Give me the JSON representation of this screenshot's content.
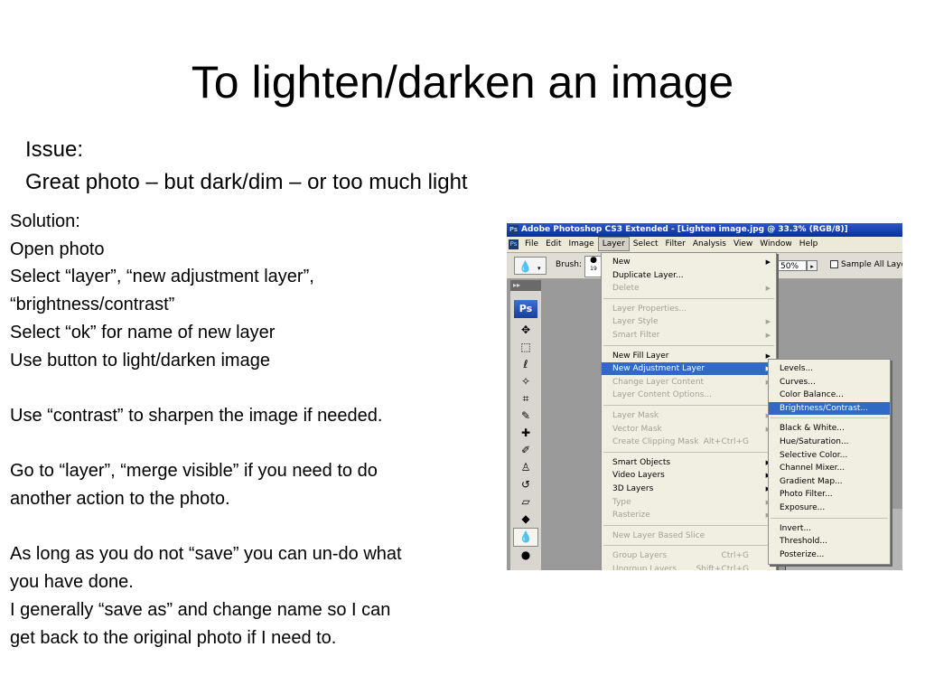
{
  "slide": {
    "title": "To lighten/darken an image",
    "issue": [
      "Issue:",
      "Great photo – but dark/dim – or too much light"
    ],
    "solution": [
      "Solution:",
      "Open photo",
      "Select “layer”, “new adjustment layer”,",
      "“brightness/contrast”",
      "Select “ok” for name of new layer",
      "Use button to light/darken image",
      "",
      "Use “contrast” to sharpen the image if needed.",
      "",
      "Go to “layer”, “merge visible” if you need to do",
      "another action to the photo.",
      "",
      "As long as you do not “save” you can un-do what",
      "you have done.",
      "I generally “save as” and change name so I can",
      "get back to the original photo if I need to."
    ]
  },
  "photoshop": {
    "title": "Adobe Photoshop CS3 Extended - [Lighten image.jpg @ 33.3% (RGB/8)]",
    "logo": "Ps",
    "menubar": [
      "File",
      "Edit",
      "Image",
      "Layer",
      "Select",
      "Filter",
      "Analysis",
      "View",
      "Window",
      "Help"
    ],
    "active_menu": "Layer",
    "options": {
      "brush_label": "Brush:",
      "brush_size": "19",
      "zoom": "50%",
      "sample_label": "Sample All Layers"
    },
    "toolbox_logo": "Ps",
    "tool_icons": [
      "move-icon",
      "marquee-icon",
      "lasso-icon",
      "magic-wand-icon",
      "crop-icon",
      "eyedropper-icon",
      "spot-healing-icon",
      "brush-icon",
      "clone-stamp-icon",
      "history-brush-icon",
      "eraser-icon",
      "paint-bucket-icon",
      "blur-icon",
      "dodge-icon"
    ],
    "layer_menu": [
      {
        "label": "New",
        "submenu": true
      },
      {
        "label": "Duplicate Layer..."
      },
      {
        "label": "Delete",
        "disabled": true,
        "submenu": true
      },
      {
        "sep": true
      },
      {
        "label": "Layer Properties...",
        "disabled": true
      },
      {
        "label": "Layer Style",
        "disabled": true,
        "submenu": true
      },
      {
        "label": "Smart Filter",
        "disabled": true,
        "submenu": true
      },
      {
        "sep": true
      },
      {
        "label": "New Fill Layer",
        "submenu": true
      },
      {
        "label": "New Adjustment Layer",
        "submenu": true,
        "highlighted": true
      },
      {
        "label": "Change Layer Content",
        "disabled": true,
        "submenu": true
      },
      {
        "label": "Layer Content Options...",
        "disabled": true
      },
      {
        "sep": true
      },
      {
        "label": "Layer Mask",
        "disabled": true,
        "submenu": true
      },
      {
        "label": "Vector Mask",
        "disabled": true,
        "submenu": true
      },
      {
        "label": "Create Clipping Mask",
        "disabled": true,
        "shortcut": "Alt+Ctrl+G"
      },
      {
        "sep": true
      },
      {
        "label": "Smart Objects",
        "submenu": true
      },
      {
        "label": "Video Layers",
        "submenu": true
      },
      {
        "label": "3D Layers",
        "submenu": true
      },
      {
        "label": "Type",
        "disabled": true,
        "submenu": true
      },
      {
        "label": "Rasterize",
        "disabled": true,
        "submenu": true
      },
      {
        "sep": true
      },
      {
        "label": "New Layer Based Slice",
        "disabled": true
      },
      {
        "sep": true
      },
      {
        "label": "Group Layers",
        "disabled": true,
        "shortcut": "Ctrl+G"
      },
      {
        "label": "Ungroup Layers",
        "disabled": true,
        "shortcut": "Shift+Ctrl+G"
      }
    ],
    "adjustment_menu": [
      {
        "label": "Levels..."
      },
      {
        "label": "Curves..."
      },
      {
        "label": "Color Balance..."
      },
      {
        "label": "Brightness/Contrast...",
        "highlighted": true
      },
      {
        "sep": true
      },
      {
        "label": "Black & White..."
      },
      {
        "label": "Hue/Saturation..."
      },
      {
        "label": "Selective Color..."
      },
      {
        "label": "Channel Mixer..."
      },
      {
        "label": "Gradient Map..."
      },
      {
        "label": "Photo Filter..."
      },
      {
        "label": "Exposure..."
      },
      {
        "sep": true
      },
      {
        "label": "Invert..."
      },
      {
        "label": "Threshold..."
      },
      {
        "label": "Posterize..."
      }
    ]
  }
}
